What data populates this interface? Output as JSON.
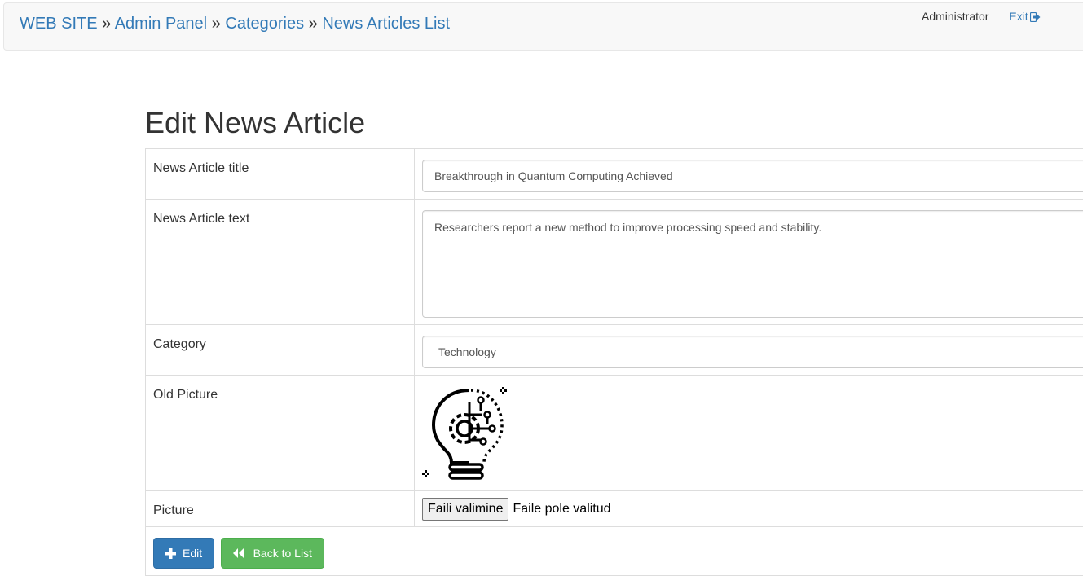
{
  "breadcrumb": {
    "items": [
      "WEB SITE",
      "Admin Panel",
      "Categories",
      "News Articles List"
    ],
    "separator": "»"
  },
  "user": {
    "name": "Administrator",
    "exit_label": "Exit",
    "exit_icon": "log-out-icon"
  },
  "page": {
    "title": "Edit News Article"
  },
  "form": {
    "title_label": "News Article title",
    "title_value": "Breakthrough in Quantum Computing Achieved",
    "text_label": "News Article text",
    "text_value": "Researchers report a new method to improve processing speed and stability.",
    "category_label": "Category",
    "category_value": "Technology",
    "old_picture_label": "Old Picture",
    "old_picture_icon": "lightbulb-circuit-icon",
    "picture_label": "Picture",
    "file_button": "Faili valimine",
    "file_status": "Faile pole valitud"
  },
  "actions": {
    "edit_label": "Edit",
    "edit_icon": "plus-icon",
    "back_label": "Back to List",
    "back_icon": "backward-icon"
  },
  "colors": {
    "link": "#337ab7",
    "primary": "#337ab7",
    "success": "#5cb85c",
    "navbar_bg": "#f8f8f8",
    "border": "#dddddd"
  }
}
